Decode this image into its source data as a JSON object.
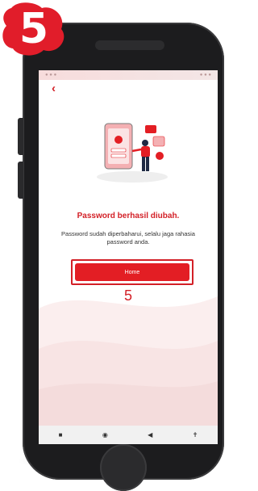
{
  "step_badge": "5",
  "screen": {
    "title": "Password berhasil diubah.",
    "message": "Password sudah diperbaharui, selalu jaga rahasia password anda.",
    "home_button_label": "Home",
    "step_marker": "5"
  },
  "nav": {
    "recents_icon": "■",
    "home_icon": "◉",
    "back_icon": "◀",
    "accessibility_icon": "✝"
  },
  "colors": {
    "accent": "#e31e24",
    "badge": "#e11d2a"
  }
}
